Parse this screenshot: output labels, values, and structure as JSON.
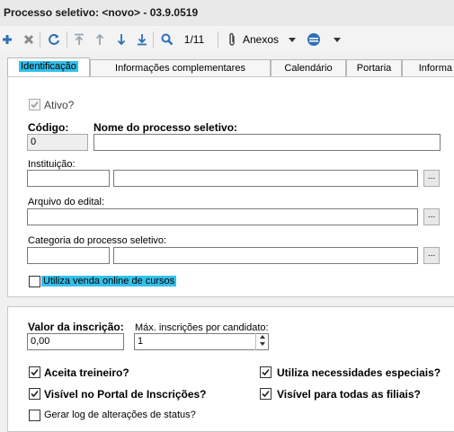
{
  "window": {
    "title": "Processo seletivo: <novo> - 03.9.0519"
  },
  "toolbar": {
    "record_counter": "1/11",
    "attachments_label": "Anexos",
    "icons": [
      "plus-icon",
      "delete-icon",
      "refresh-icon",
      "first-record-icon",
      "previous-record-icon",
      "next-record-icon",
      "last-record-icon",
      "search-icon",
      "paperclip-icon",
      "options-icon"
    ]
  },
  "tabs": [
    {
      "label": "Identificação",
      "active": true
    },
    {
      "label": "Informações complementares"
    },
    {
      "label": "Calendário"
    },
    {
      "label": "Portaria"
    },
    {
      "label": "Informa"
    }
  ],
  "form": {
    "ativo_label": "Ativo?",
    "codigo_label": "Código:",
    "codigo_value": "0",
    "nome_label": "Nome do processo seletivo:",
    "nome_value": "",
    "instituicao_label": "Instituição:",
    "arquivo_label": "Arquivo do edital:",
    "categoria_label": "Categoria do processo seletivo:",
    "browse_label": "...",
    "venda_online_label": "Utiliza venda online de cursos",
    "valor_label": "Valor da inscrição:",
    "valor_value": "0,00",
    "max_inscricoes_label": "Máx. inscrições por candidato:",
    "max_inscricoes_value": "1",
    "aceita_treineiro_label": "Aceita treineiro?",
    "necessidades_label": "Utiliza necessidades especiais?",
    "visivel_portal_label": "Visível no Portal de Inscrições?",
    "visivel_filiais_label": "Visível para todas as filiais?",
    "gerar_log_label": "Gerar log de alterações de status?"
  },
  "colors": {
    "highlight": "#33c0ea",
    "toolbar_icon": "#2e6fb8"
  }
}
